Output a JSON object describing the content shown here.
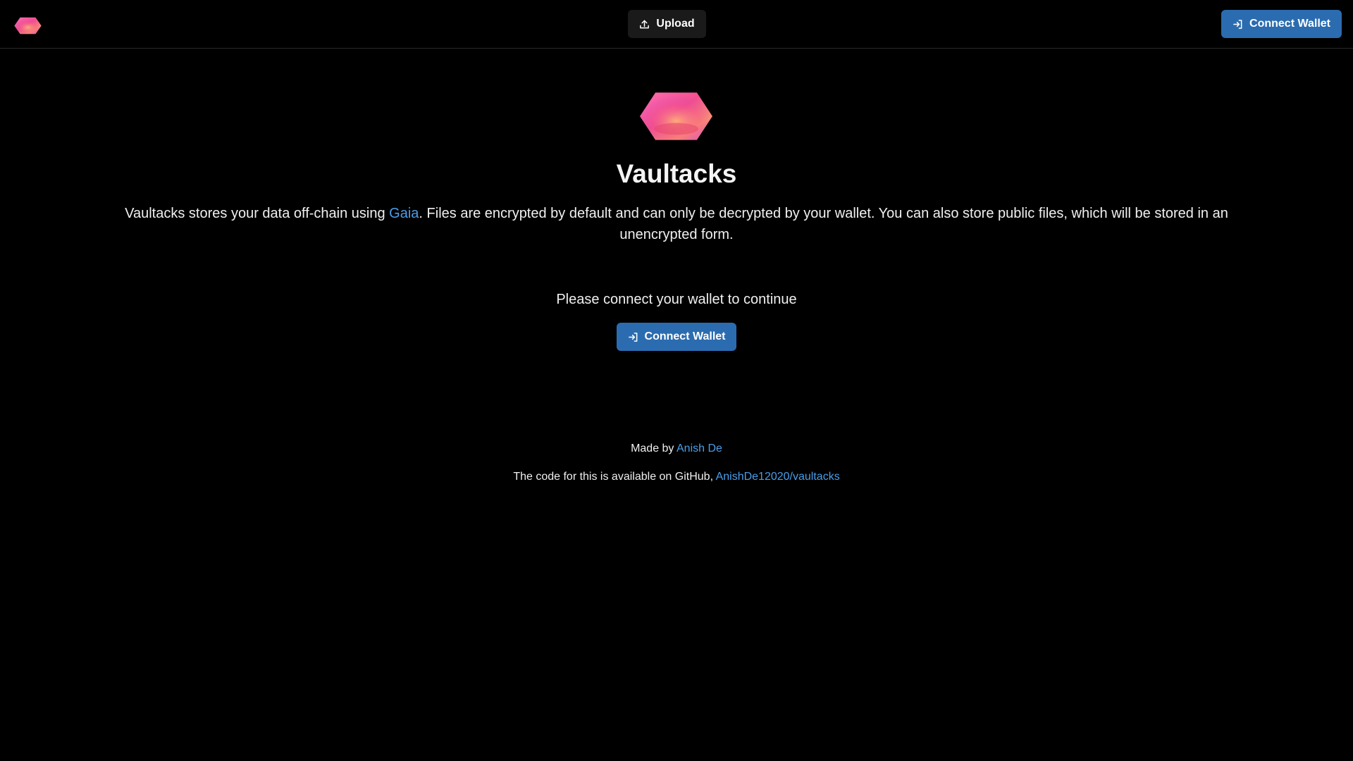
{
  "header": {
    "logo_icon": "vaultacks-hexagon-logo",
    "upload_label": "Upload",
    "upload_icon": "upload-icon",
    "connect_label": "Connect Wallet",
    "connect_icon": "login-icon"
  },
  "hero": {
    "logo_icon": "vaultacks-hexagon-logo",
    "title": "Vaultacks",
    "description_before": "Vaultacks stores your data off-chain using ",
    "gaia_link": "Gaia",
    "description_after": ". Files are encrypted by default and can only be decrypted by your wallet. You can also store public files, which will be stored in an unencrypted form.",
    "prompt": "Please connect your wallet to continue",
    "connect_label": "Connect Wallet"
  },
  "footer": {
    "made_by_prefix": "Made by ",
    "author_link": "Anish De",
    "code_prefix": "The code for this is available on GitHub, ",
    "repo_link": "AnishDe12020/vaultacks"
  },
  "colors": {
    "background": "#000000",
    "primary_button": "#2b6cb0",
    "secondary_button": "#1a1a1a",
    "link": "#4a9eea"
  }
}
